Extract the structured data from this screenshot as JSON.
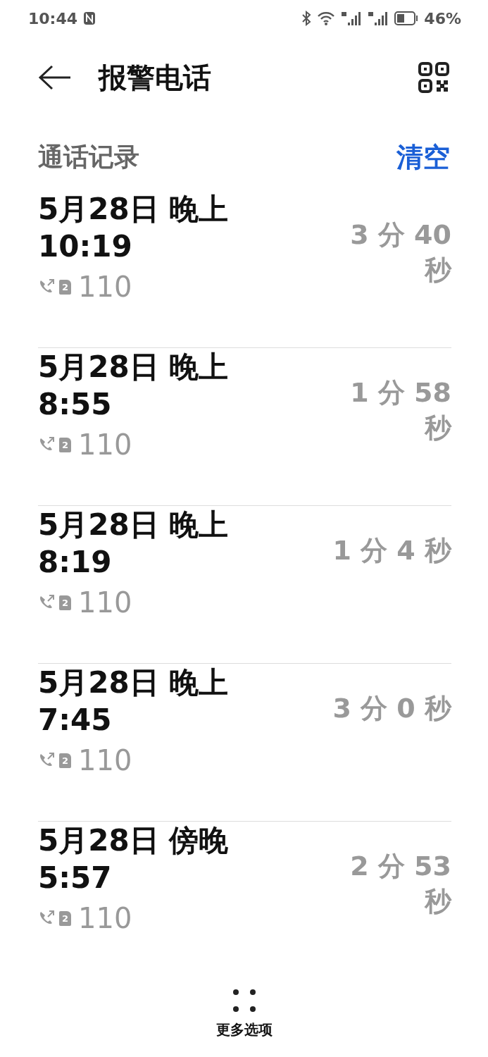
{
  "status_bar": {
    "time": "10:44",
    "battery": "46%"
  },
  "header": {
    "title": "报警电话"
  },
  "section": {
    "title": "通话记录",
    "action": "清空"
  },
  "calls": [
    {
      "date": "5月28日 晚上",
      "time": "10:19",
      "sim": "2",
      "number": "110",
      "duration": "3 分 40 秒"
    },
    {
      "date": "5月28日 晚上",
      "time": "8:55",
      "sim": "2",
      "number": "110",
      "duration": "1 分 58 秒"
    },
    {
      "date": "5月28日 晚上",
      "time": "8:19",
      "sim": "2",
      "number": "110",
      "duration": "1 分 4 秒"
    },
    {
      "date": "5月28日 晚上",
      "time": "7:45",
      "sim": "2",
      "number": "110",
      "duration": "3 分 0 秒"
    },
    {
      "date": "5月28日 傍晚",
      "time": "5:57",
      "sim": "2",
      "number": "110",
      "duration": "2 分 53 秒"
    }
  ],
  "more": {
    "label": "更多选项"
  }
}
